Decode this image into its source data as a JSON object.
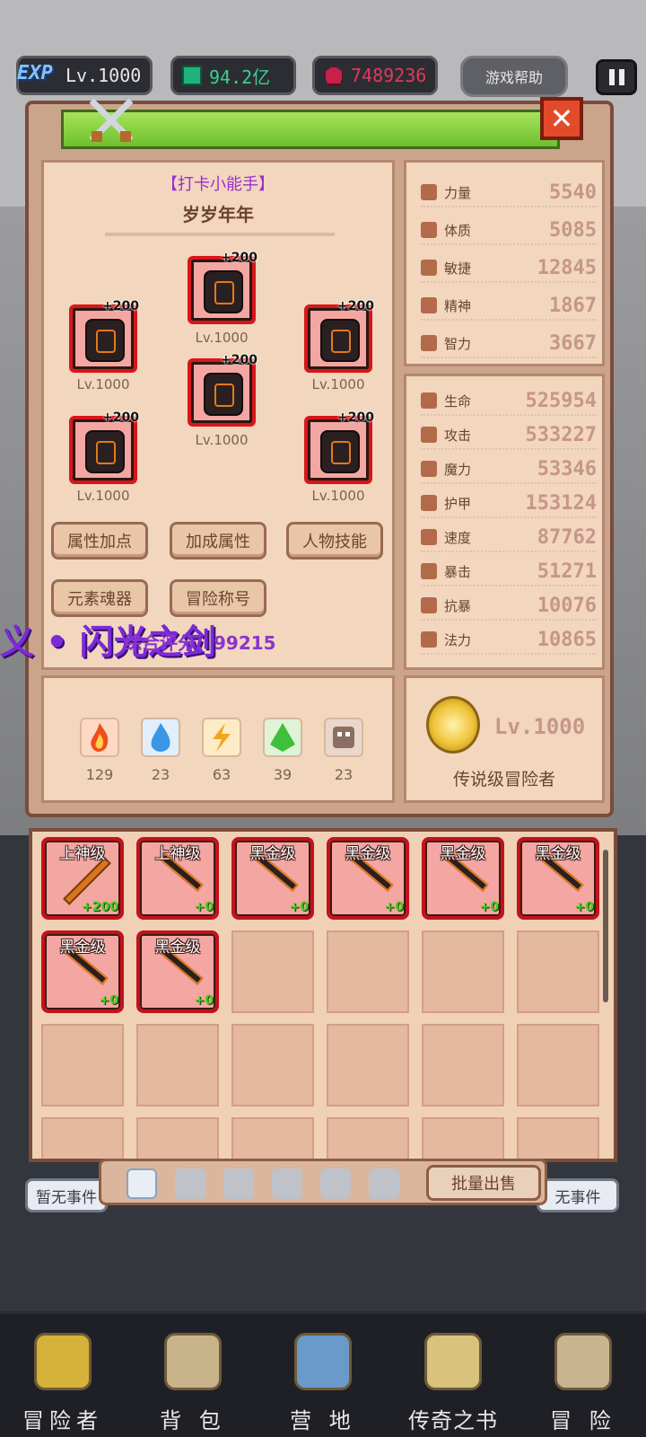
{
  "topbar": {
    "exp_badge": "EXP",
    "level": "Lv.1000",
    "green_currency": "94.2亿",
    "red_currency": "7489236",
    "help_label": "游戏帮助"
  },
  "panel": {
    "close_label": "✕",
    "title_tag": "【打卡小能手】",
    "title_name": "岁岁年年",
    "equipment": [
      {
        "plus": "+200",
        "level": "Lv.1000"
      },
      {
        "plus": "+200",
        "level": "Lv.1000"
      },
      {
        "plus": "+200",
        "level": "Lv.1000"
      },
      {
        "plus": "+200",
        "level": "Lv.1000"
      },
      {
        "plus": "+200",
        "level": "Lv.1000"
      },
      {
        "plus": "+200",
        "level": "Lv.1000"
      }
    ],
    "buttons": {
      "attr_points": "属性加点",
      "bonus_attr": "加成属性",
      "char_skills": "人物技能",
      "element_soul": "元素魂器",
      "adventure_title": "冒险称号"
    },
    "overlay_text": "义 • 闪光之剑",
    "overlay_score": "综合评分：99215",
    "elements": [
      {
        "name": "fire",
        "count": "129"
      },
      {
        "name": "water",
        "count": "23"
      },
      {
        "name": "thunder",
        "count": "63"
      },
      {
        "name": "wind",
        "count": "39"
      },
      {
        "name": "dark",
        "count": "23"
      }
    ],
    "base_stats": [
      {
        "name": "力量",
        "value": "5540"
      },
      {
        "name": "体质",
        "value": "5085"
      },
      {
        "name": "敏捷",
        "value": "12845"
      },
      {
        "name": "精神",
        "value": "1867"
      },
      {
        "name": "智力",
        "value": "3667"
      }
    ],
    "combat_stats": [
      {
        "name": "生命",
        "value": "525954"
      },
      {
        "name": "攻击",
        "value": "533227"
      },
      {
        "name": "魔力",
        "value": "53346"
      },
      {
        "name": "护甲",
        "value": "153124"
      },
      {
        "name": "速度",
        "value": "87762"
      },
      {
        "name": "暴击",
        "value": "51271"
      },
      {
        "name": "抗暴",
        "value": "10076"
      },
      {
        "name": "法力",
        "value": "10865"
      }
    ],
    "rank": {
      "level": "Lv.1000",
      "name": "传说级冒险者"
    }
  },
  "inventory": {
    "items": [
      {
        "rank": "上神级",
        "plus": "+200"
      },
      {
        "rank": "上神级",
        "plus": "+0"
      },
      {
        "rank": "黑金级",
        "plus": "+0"
      },
      {
        "rank": "黑金级",
        "plus": "+0"
      },
      {
        "rank": "黑金级",
        "plus": "+0"
      },
      {
        "rank": "黑金级",
        "plus": "+0"
      },
      {
        "rank": "黑金级",
        "plus": "+0"
      },
      {
        "rank": "黑金级",
        "plus": "+0"
      }
    ],
    "bulk_sell": "批量出售",
    "left_event": "暂无事件",
    "right_event": "无事件"
  },
  "nav": {
    "adventurer": "冒险者",
    "backpack": "背 包",
    "camp": "营 地",
    "legend_book": "传奇之书",
    "adventure": "冒 险"
  }
}
